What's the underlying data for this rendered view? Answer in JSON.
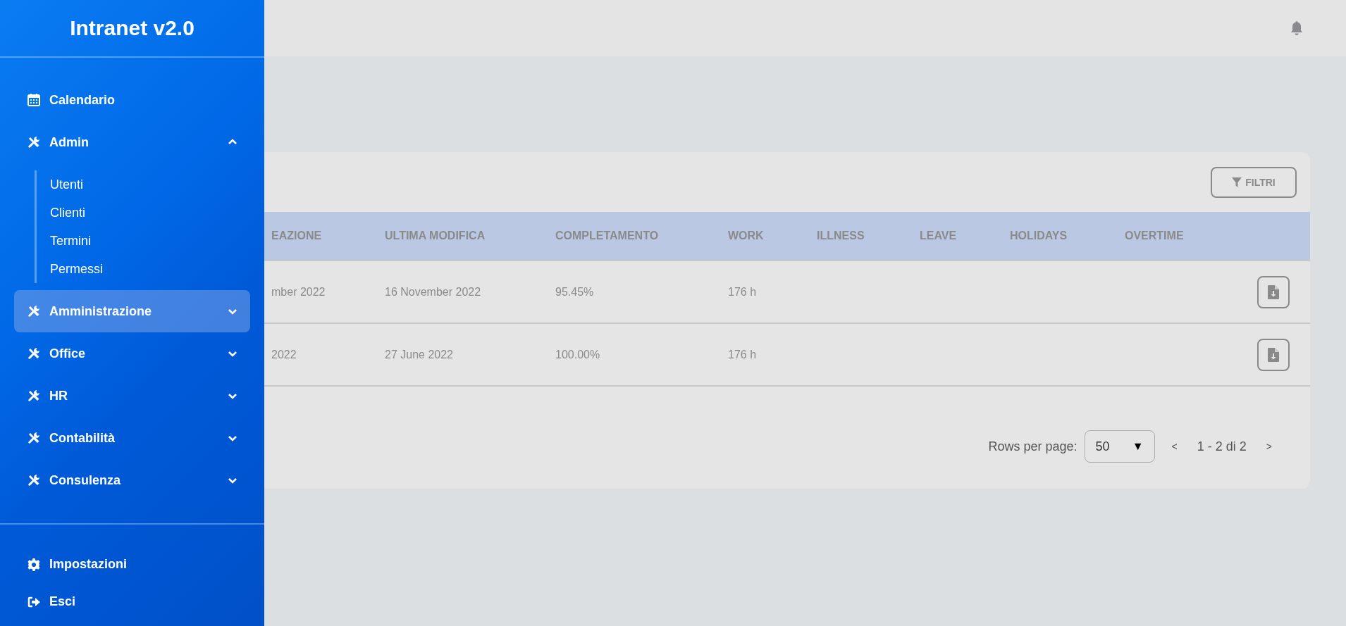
{
  "sidebar": {
    "title": "Intranet v2.0",
    "items": [
      {
        "label": "Calendario",
        "kind": "link",
        "selected": false
      },
      {
        "label": "Admin",
        "kind": "group",
        "expanded": true,
        "selected": false,
        "children": [
          {
            "label": "Utenti"
          },
          {
            "label": "Clienti"
          },
          {
            "label": "Termini"
          },
          {
            "label": "Permessi"
          }
        ]
      },
      {
        "label": "Amministrazione",
        "kind": "group",
        "expanded": false,
        "selected": true
      },
      {
        "label": "Office",
        "kind": "group",
        "expanded": false,
        "selected": false
      },
      {
        "label": "HR",
        "kind": "group",
        "expanded": false,
        "selected": false
      },
      {
        "label": "Contabilità",
        "kind": "group",
        "expanded": false,
        "selected": false
      },
      {
        "label": "Consulenza",
        "kind": "group",
        "expanded": false,
        "selected": false
      }
    ],
    "footer_items": [
      {
        "label": "Impostazioni",
        "kind": "settings"
      },
      {
        "label": "Esci",
        "kind": "logout"
      }
    ]
  },
  "table": {
    "filter_button": "FILTRI",
    "columns": [
      "EAZIONE",
      "ULTIMA MODIFICA",
      "COMPLETAMENTO",
      "WORK",
      "ILLNESS",
      "LEAVE",
      "HOLIDAYS",
      "OVERTIME"
    ],
    "rows": [
      {
        "cells": [
          "mber 2022",
          "16 November 2022",
          "95.45%",
          "176 h"
        ]
      },
      {
        "cells": [
          "2022",
          "27 June 2022",
          "100.00%",
          "176 h"
        ]
      }
    ],
    "pagination": {
      "rows_per_page_label": "Rows per page:",
      "rows_per_page": "50",
      "select_arrow": "▼",
      "prev": "<",
      "range": "1 - 2 di 2",
      "next": ">"
    }
  }
}
